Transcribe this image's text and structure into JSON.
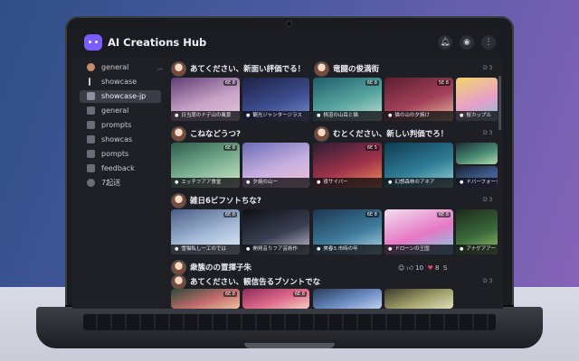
{
  "app": {
    "title": "AI Creations Hub"
  },
  "header": {
    "buttons": [
      "bell-icon",
      "user-icon",
      "more-icon"
    ]
  },
  "sidebar": {
    "items": [
      {
        "label": "general",
        "icon": "avatar-icon",
        "active": false
      },
      {
        "label": "showcase",
        "icon": "channel-icon",
        "active": false
      },
      {
        "label": "showcase-jp",
        "icon": "image-icon",
        "active": true
      },
      {
        "label": "general",
        "icon": "channel-icon",
        "active": false
      },
      {
        "label": "prompts",
        "icon": "channel-icon",
        "active": false
      },
      {
        "label": "showcas",
        "icon": "channel-icon",
        "active": false
      },
      {
        "label": "pompts",
        "icon": "channel-icon",
        "active": false
      },
      {
        "label": "feedback",
        "icon": "channel-icon",
        "active": false
      },
      {
        "label": "7起送",
        "icon": "group-icon",
        "active": false
      }
    ]
  },
  "posts": [
    {
      "title": "あてください、新面い評価でる！",
      "badge": "",
      "thumbs": [
        {
          "tag": "6E 8",
          "caption": "日当席のドデ山の風景",
          "palette": [
            "#5d3d73",
            "#c9a3c8",
            "#e6c6d8"
          ]
        },
        {
          "tag": "",
          "caption": "観光ジャンタージラス",
          "palette": [
            "#1d2243",
            "#3c4c8e",
            "#7a8fd0"
          ]
        }
      ]
    },
    {
      "title": "竜闘の俊満街",
      "badge": "D 3",
      "thumbs": [
        {
          "tag": "6E 8",
          "caption": "桃道の山岳と猫",
          "palette": [
            "#1f5d6a",
            "#58a6a0",
            "#c7e2d6"
          ]
        },
        {
          "tag": "5E 8",
          "caption": "猫の山の夕焼け",
          "palette": [
            "#5b1f2d",
            "#a3405a",
            "#e8c1a0"
          ]
        },
        {
          "tag": "",
          "caption": "桜カップル",
          "palette": [
            "#f1d56e",
            "#e9a0c8",
            "#7fc3d6"
          ]
        }
      ]
    },
    {
      "title": "こねなどうつ?",
      "badge": "",
      "thumbs": [
        {
          "tag": "6E 8",
          "caption": "エッチフアア食堂",
          "palette": [
            "#2d5a4a",
            "#7fb596",
            "#d8e8c8"
          ]
        },
        {
          "tag": "",
          "caption": "夕焼の山ー",
          "palette": [
            "#6b6cb8",
            "#c8b0e0",
            "#f1c0d6"
          ]
        }
      ]
    },
    {
      "title": "むとください、新しい判価でろ！",
      "badge": "D 3",
      "thumbs": [
        {
          "tag": "6E 5",
          "caption": "夜サイバー",
          "palette": [
            "#2a1d33",
            "#a0324a",
            "#f08f5a"
          ]
        },
        {
          "tag": "",
          "caption": "幻想森林のアネア",
          "palette": [
            "#0f3a52",
            "#2f7c95",
            "#9ad6d8"
          ]
        },
        {
          "tag": "",
          "caption": "",
          "palette": [
            "#1a2e38",
            "#4a8a72",
            "#b0d8b0"
          ]
        },
        {
          "tag": "",
          "caption": "ドバーフォーク",
          "palette": [
            "#1a2230",
            "#3d5c8a",
            "#7c4fa8"
          ]
        }
      ]
    },
    {
      "title": "雑日6ビフソトちな?",
      "badge": "D 3",
      "thumbs": [
        {
          "tag": "6E 8",
          "caption": "雪猫私し一工のでは",
          "palette": [
            "#4a5e86",
            "#a6bbd8",
            "#e7eef8"
          ]
        },
        {
          "tag": "",
          "caption": "開発芸りフア芸術作",
          "palette": [
            "#0e1016",
            "#3a3f52",
            "#c8c9d8"
          ]
        },
        {
          "tag": "6E 8",
          "caption": "美春3.市時の年",
          "palette": [
            "#1d3650",
            "#3d7a9a",
            "#b8d8ea"
          ]
        },
        {
          "tag": "6E 8",
          "caption": "ドローンの王国",
          "palette": [
            "#f2dff0",
            "#e678c4",
            "#79d2e8"
          ]
        },
        {
          "tag": "",
          "caption": "アナゲアアー",
          "palette": [
            "#1d2a1d",
            "#3a6a3a",
            "#a0c870"
          ]
        }
      ]
    },
    {
      "title": "衆簇のの置揮子朱",
      "badge": "",
      "reactions": {
        "icon": "heart-icon",
        "count1": "10",
        "count2": "8",
        "count3": "S"
      }
    },
    {
      "title": "あてください、観信告るブソントでな",
      "badge": "D 3",
      "thumbs": [
        {
          "tag": "6E 8",
          "caption": "",
          "palette": [
            "#2a4a3a",
            "#c06a6a",
            "#f0c0a0"
          ]
        },
        {
          "tag": "6E 8",
          "caption": "",
          "palette": [
            "#8a2a5a",
            "#e06a8a",
            "#f0d0c0"
          ]
        },
        {
          "tag": "",
          "caption": "",
          "palette": [
            "#2a3a5a",
            "#6a8ac0",
            "#c0d0f0"
          ]
        },
        {
          "tag": "",
          "caption": "",
          "palette": [
            "#3a3a2a",
            "#a0a06a",
            "#e0e0c0"
          ]
        }
      ]
    }
  ]
}
